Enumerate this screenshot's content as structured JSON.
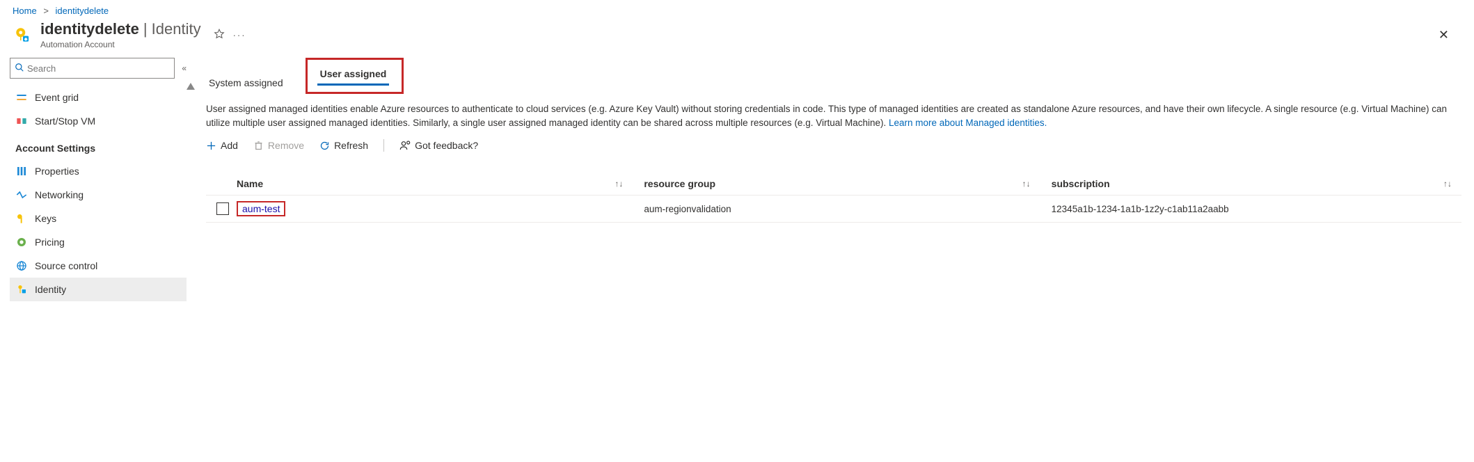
{
  "breadcrumb": {
    "home": "Home",
    "current": "identitydelete"
  },
  "header": {
    "title_primary": "identitydelete",
    "title_secondary": "| Identity",
    "subtitle": "Automation Account"
  },
  "sidebar": {
    "search_placeholder": "Search",
    "items": [
      {
        "label": "Event grid"
      },
      {
        "label": "Start/Stop VM"
      }
    ],
    "section_label": "Account Settings",
    "settings_items": [
      {
        "label": "Properties"
      },
      {
        "label": "Networking"
      },
      {
        "label": "Keys"
      },
      {
        "label": "Pricing"
      },
      {
        "label": "Source control"
      },
      {
        "label": "Identity"
      }
    ]
  },
  "tabs": {
    "system": "System assigned",
    "user": "User assigned"
  },
  "description": {
    "body": "User assigned managed identities enable Azure resources to authenticate to cloud services (e.g. Azure Key Vault) without storing credentials in code. This type of managed identities are created as standalone Azure resources, and have their own lifecycle. A single resource (e.g. Virtual Machine) can utilize multiple user assigned managed identities. Similarly, a single user assigned managed identity can be shared across multiple resources (e.g. Virtual Machine). ",
    "link": "Learn more about Managed identities."
  },
  "toolbar": {
    "add": "Add",
    "remove": "Remove",
    "refresh": "Refresh",
    "feedback": "Got feedback?"
  },
  "table": {
    "headers": {
      "name": "Name",
      "resource_group": "resource group",
      "subscription": "subscription"
    },
    "rows": [
      {
        "name": "aum-test",
        "resource_group": "aum-regionvalidation",
        "subscription": "12345a1b-1234-1a1b-1z2y-c1ab11a2aabb"
      }
    ]
  }
}
